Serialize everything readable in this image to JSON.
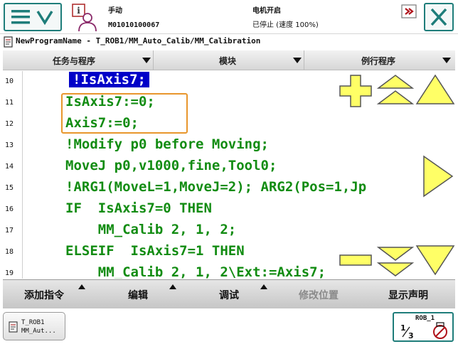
{
  "status": {
    "mode": "手动",
    "controller": "M01010100067",
    "motor": "电机开启",
    "run_state": "已停止 (速度 100%)"
  },
  "breadcrumb": "NewProgramName - T_ROB1/MM_Auto_Calib/MM_Calibration",
  "dropdowns": [
    {
      "label": "任务与程序"
    },
    {
      "label": "模块"
    },
    {
      "label": "例行程序"
    }
  ],
  "code_lines": [
    {
      "num": "10",
      "text": "!IsAxis7;"
    },
    {
      "num": "11",
      "text": "IsAxis7:=0;"
    },
    {
      "num": "12",
      "text": "Axis7:=0;"
    },
    {
      "num": "13",
      "text": "!Modify p0 before Moving;"
    },
    {
      "num": "14",
      "text": "MoveJ p0,v1000,fine,Tool0;"
    },
    {
      "num": "15",
      "text": "!ARG1(MoveL=1,MoveJ=2); ARG2(Pos=1,Jp"
    },
    {
      "num": "16",
      "text": "IF  IsAxis7=0 THEN"
    },
    {
      "num": "17",
      "text": "    MM_Calib 2, 1, 2;"
    },
    {
      "num": "18",
      "text": "ELSEIF  IsAxis7=1 THEN"
    },
    {
      "num": "19",
      "text": "    MM_Calib 2, 1, 2\\Ext:=Axis7;"
    }
  ],
  "toolbar": {
    "add_instruction": "添加指令",
    "edit": "编辑",
    "debug": "调试",
    "modify_position": "修改位置",
    "show_declarations": "显示声明"
  },
  "taskbar": {
    "tab_line1": "T_ROB1",
    "tab_line2": "MM_Aut...",
    "robot": "ROB_1"
  },
  "colors": {
    "accent": "#1e7d7a",
    "code_text": "#128c12",
    "selection": "#0000c8",
    "highlight_box": "#e8962c",
    "overlay_yellow": "#ffff66"
  }
}
